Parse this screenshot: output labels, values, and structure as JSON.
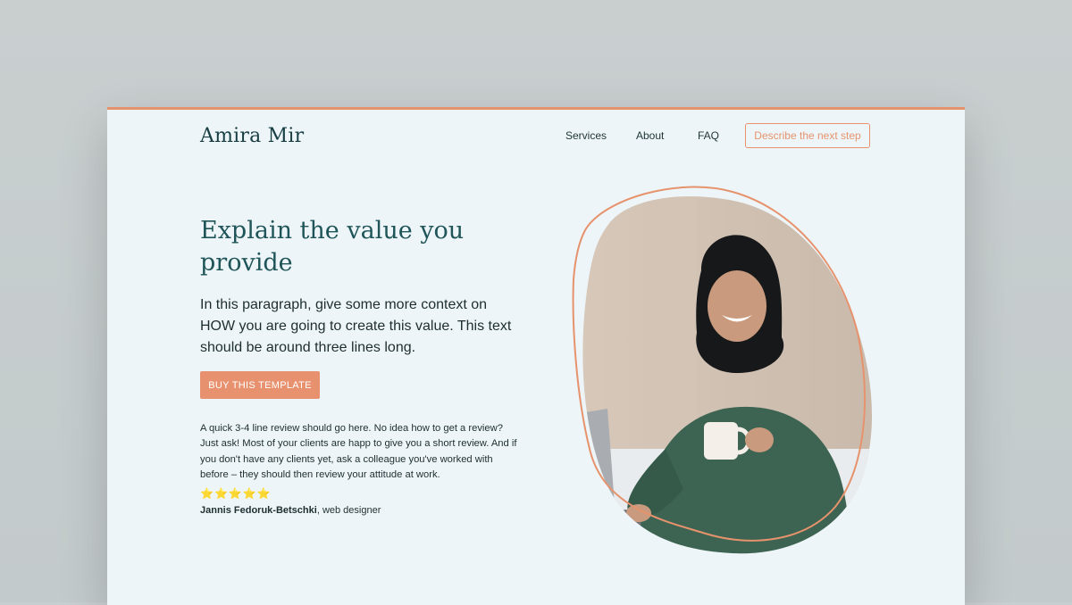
{
  "header": {
    "brand": "Amira Mir",
    "nav": [
      "Services",
      "About",
      "FAQ"
    ],
    "cta_label": "Describe the next step"
  },
  "hero": {
    "headline": "Explain the value you provide",
    "paragraph": "In this paragraph, give some more context on HOW you are going to create this value. This text should be around three lines long.",
    "button_label": "BUY THIS TEMPLATE",
    "review_text": "A quick 3-4 line review should go here. No idea how to get a review? Just ask! Most of your clients are happ to give you a short review. And if you don't have any clients yet, ask a colleague you've worked with before – they should then review your attitude at work.",
    "rating": {
      "value": 5,
      "max": 5,
      "glyphs": "⭐⭐⭐⭐⭐"
    },
    "reviewer_name": "Jannis Fedoruk-Betschki",
    "reviewer_role": ", web designer"
  },
  "colors": {
    "accent": "#e8916f",
    "heading": "#1f5558",
    "background": "#eef5f8"
  },
  "icons": [
    "star-icon"
  ]
}
